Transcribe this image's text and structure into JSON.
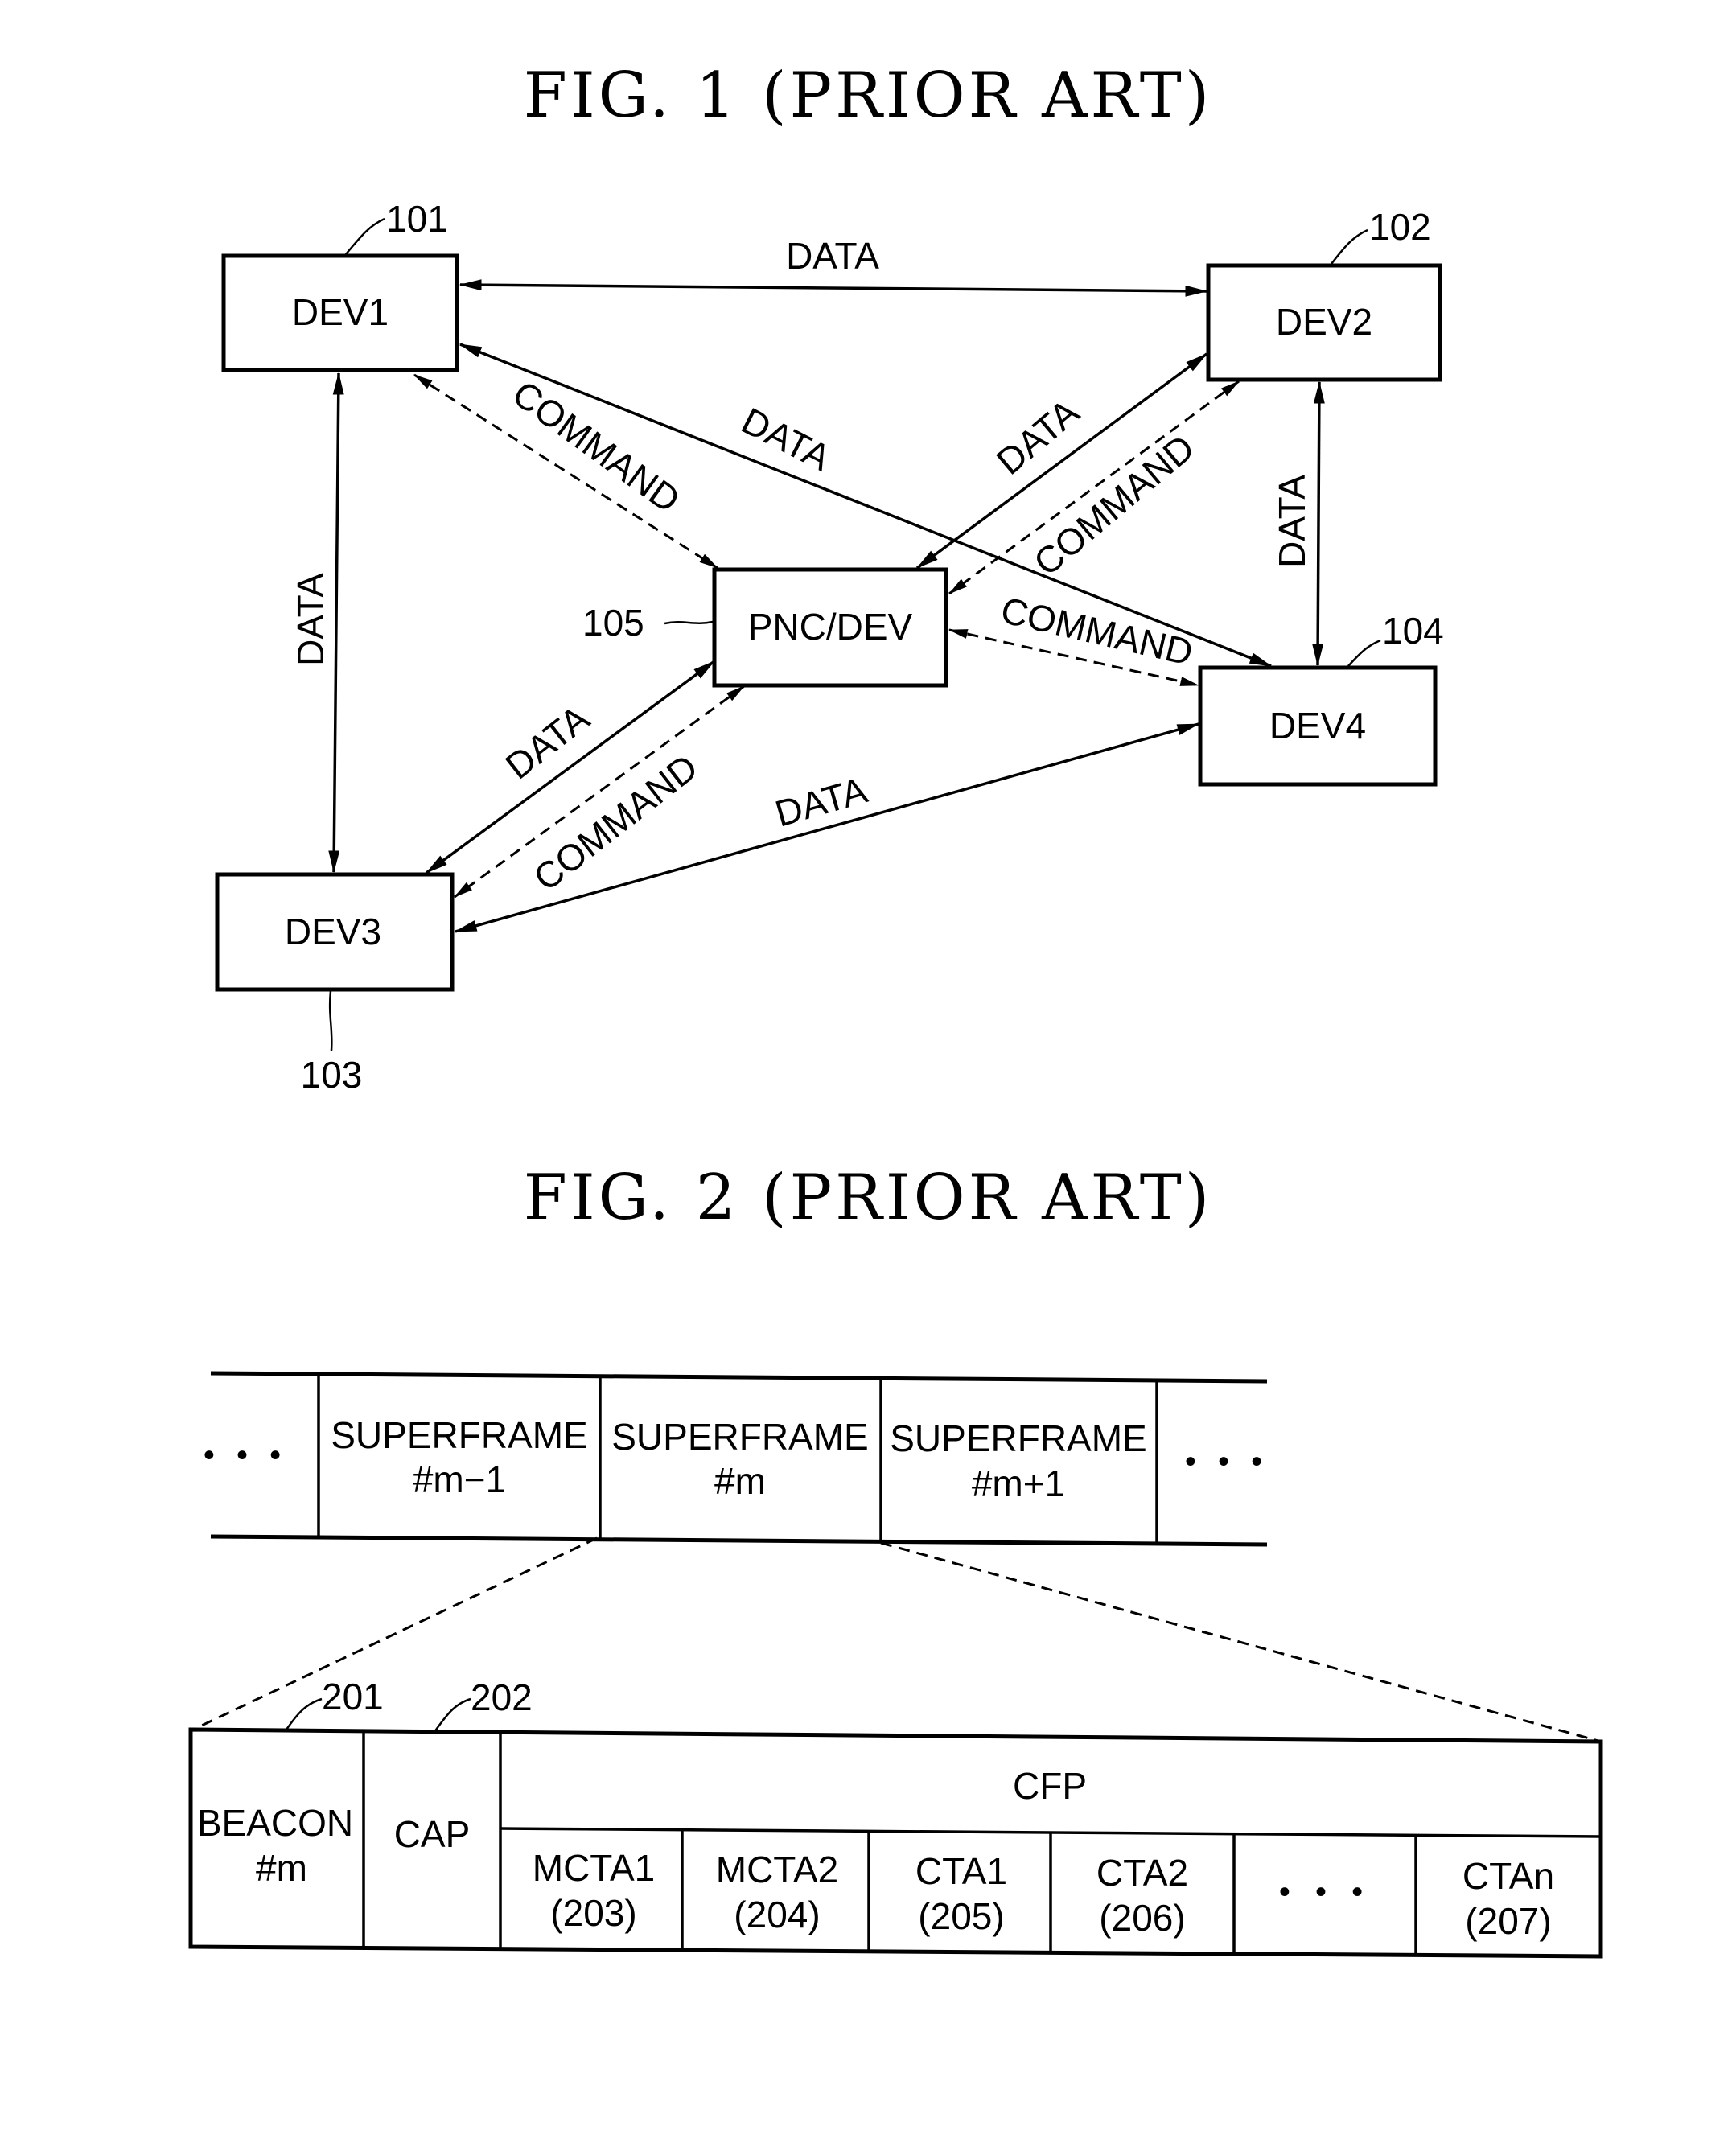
{
  "fig1": {
    "title": "FIG. 1 (PRIOR ART)",
    "nodes": {
      "dev1": {
        "label": "DEV1",
        "ref": "101"
      },
      "dev2": {
        "label": "DEV2",
        "ref": "102"
      },
      "dev3": {
        "label": "DEV3",
        "ref": "103"
      },
      "dev4": {
        "label": "DEV4",
        "ref": "104"
      },
      "pnc": {
        "label": "PNC/DEV",
        "ref": "105"
      }
    },
    "edges": {
      "dev1_dev2_data": "DATA",
      "dev1_dev3_data": "DATA",
      "dev1_dev4_data": "DATA",
      "dev1_pnc_command": "COMMAND",
      "dev2_pnc_data": "DATA",
      "dev2_pnc_command": "COMMAND",
      "dev2_dev4_data": "DATA",
      "pnc_dev4_command": "COMMAND",
      "pnc_dev3_data": "DATA",
      "pnc_dev3_command": "COMMAND",
      "dev3_dev4_data": "DATA"
    }
  },
  "fig2": {
    "title": "FIG. 2 (PRIOR ART)",
    "ellipsis": "• • •",
    "superframes": [
      {
        "line1": "SUPERFRAME",
        "line2": "#m−1"
      },
      {
        "line1": "SUPERFRAME",
        "line2": "#m"
      },
      {
        "line1": "SUPERFRAME",
        "line2": "#m+1"
      }
    ],
    "beacon": {
      "line1": "BEACON",
      "line2": "#m",
      "ref": "201"
    },
    "cap": {
      "label": "CAP",
      "ref": "202"
    },
    "cfp": {
      "label": "CFP"
    },
    "slots": [
      {
        "line1": "MCTA1",
        "line2": "(203)"
      },
      {
        "line1": "MCTA2",
        "line2": "(204)"
      },
      {
        "line1": "CTA1",
        "line2": "(205)"
      },
      {
        "line1": "CTA2",
        "line2": "(206)"
      },
      {
        "line1": "",
        "line2": ""
      },
      {
        "line1": "CTAn",
        "line2": "(207)"
      }
    ]
  }
}
